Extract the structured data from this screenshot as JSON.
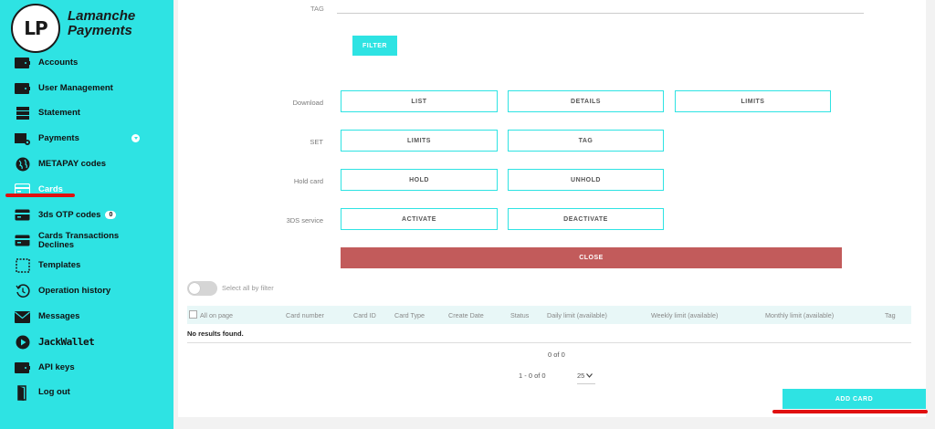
{
  "brand": {
    "logo_initials": "LP",
    "name_line1": "Lamanche",
    "name_line2": "Payments"
  },
  "sidebar": {
    "items": [
      {
        "label": "Accounts",
        "icon": "wallet-icon"
      },
      {
        "label": "User Management",
        "icon": "wallet-icon"
      },
      {
        "label": "Statement",
        "icon": "stack-icon"
      },
      {
        "label": "Payments",
        "icon": "payments-icon",
        "has_dropdown": true
      },
      {
        "label": "METAPAY codes",
        "icon": "globe-icon"
      },
      {
        "label": "Cards",
        "icon": "card-icon",
        "active": true
      },
      {
        "label": "3ds OTP codes",
        "icon": "card-icon",
        "badge": "0"
      },
      {
        "label": "Cards Transactions Declines",
        "icon": "card-icon"
      },
      {
        "label": "Templates",
        "icon": "template-icon"
      },
      {
        "label": "Operation history",
        "icon": "history-icon"
      },
      {
        "label": "Messages",
        "icon": "mail-icon"
      },
      {
        "label": "JackWallet",
        "icon": "play-icon"
      },
      {
        "label": "API keys",
        "icon": "wallet-icon"
      },
      {
        "label": "Log out",
        "icon": "door-icon"
      }
    ]
  },
  "filter_form": {
    "tag_label": "TAG",
    "tag_value": "",
    "filter_label": "FILTER"
  },
  "actions": {
    "download": {
      "label": "Download",
      "list": "LIST",
      "details": "DETAILS",
      "limits": "LIMITS"
    },
    "set": {
      "label": "SET",
      "limits": "LIMITS",
      "tag": "TAG"
    },
    "hold": {
      "label": "Hold card",
      "hold": "HOLD",
      "unhold": "UNHOLD"
    },
    "threeds": {
      "label": "3DS service",
      "activate": "ACTIVATE",
      "deactivate": "DEACTIVATE"
    },
    "close": "CLOSE"
  },
  "select_all": "Select all by filter",
  "table": {
    "all_on_page": "All on page",
    "columns": [
      "Card number",
      "Card ID",
      "Card Type",
      "Create Date",
      "Status",
      "Daily limit (available)",
      "Weekly limit (available)",
      "Monthly limit (available)",
      "Tag"
    ],
    "empty": "No results found."
  },
  "pagination": {
    "count": "0 of 0",
    "range": "1 - 0 of 0",
    "page_size": "25"
  },
  "add_card": "ADD CARD",
  "colors": {
    "accent": "#2ee3e3",
    "danger": "#c25b5b",
    "annotation": "#e01010"
  }
}
